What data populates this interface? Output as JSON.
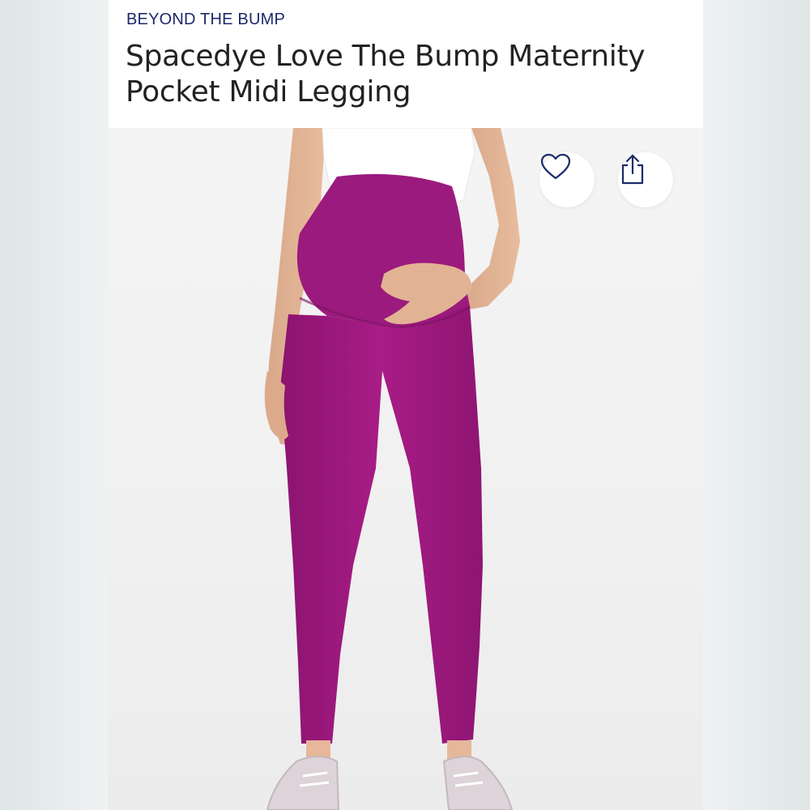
{
  "product": {
    "brand": "BEYOND THE BUMP",
    "title": "Spacedye Love The Bump Maternity Pocket Midi Legging"
  },
  "actions": {
    "favorite_icon": "heart-outline-icon",
    "share_icon": "share-upload-icon"
  },
  "colors": {
    "brand_text": "#1b2a6b",
    "legging": "#a0197f",
    "background": "#f2f2f2"
  }
}
